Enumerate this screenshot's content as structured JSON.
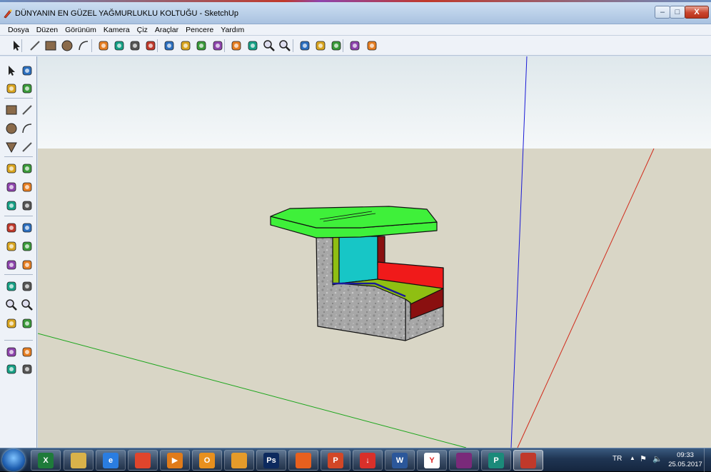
{
  "window": {
    "title": "DÜNYANIN EN GÜZEL YAĞMURLUKLU KOLTUĞU - SketchUp",
    "min_label": "–",
    "max_label": "□",
    "close_label": "X"
  },
  "menu": [
    {
      "label": "Dosya"
    },
    {
      "label": "Düzen"
    },
    {
      "label": "Görünüm"
    },
    {
      "label": "Kamera"
    },
    {
      "label": "Çiz"
    },
    {
      "label": "Araçlar"
    },
    {
      "label": "Pencere"
    },
    {
      "label": "Yardım"
    }
  ],
  "toolbar_icons": [
    "select-icon",
    "line-icon",
    "rectangle-icon",
    "circle-icon",
    "arc-icon",
    "make-component-icon",
    "eraser-icon",
    "tape-measure-icon",
    "paint-bucket-icon",
    "push-pull-icon",
    "move-icon",
    "rotate-icon",
    "follow-me-icon",
    "orbit-icon",
    "pan-icon",
    "zoom-icon",
    "zoom-extents-icon",
    "get-models-icon",
    "share-model-icon",
    "google-earth-icon",
    "component-window-icon",
    "extension-icon"
  ],
  "left_toolbar_icons": [
    "select-icon",
    "make-component-icon",
    "paint-bucket-icon",
    "eraser-icon",
    "rectangle-icon",
    "line-icon",
    "circle-icon",
    "arc-icon",
    "polygon-icon",
    "freehand-icon",
    "move-icon",
    "push-pull-icon",
    "rotate-icon",
    "follow-me-icon",
    "scale-icon",
    "offset-icon",
    "tape-measure-icon",
    "dimensions-icon",
    "protractor-icon",
    "text-icon",
    "axes-icon",
    "3d-text-icon",
    "orbit-icon",
    "pan-icon",
    "zoom-icon",
    "zoom-window-icon",
    "previous-view-icon",
    "next-view-icon",
    "position-camera-icon",
    "look-around-icon",
    "walk-icon",
    "section-plane-icon"
  ],
  "scene": {
    "sky_top": "#dfe8ec",
    "sky_bottom": "#f5f8f9",
    "ground": "#d9d6c6",
    "axis_red": "#d12a1a",
    "axis_green": "#1aa51a",
    "axis_blue": "#1a1ad6"
  },
  "model": {
    "roof_color": "#3ff03a",
    "concrete_color": "#a7a7a7",
    "cyan_panel": "#17c6c6",
    "red_panel": "#f01a1a",
    "olive_panel": "#8fbf12",
    "dark_red_panel": "#8a1010",
    "blue_edge": "#1a1a9a"
  },
  "taskbar": {
    "items": [
      {
        "name": "excel-icon",
        "glyph": "X",
        "color": "#1e7b3a"
      },
      {
        "name": "file-explorer-icon",
        "glyph": "",
        "color": "#d9b24a"
      },
      {
        "name": "internet-explorer-icon",
        "glyph": "e",
        "color": "#2a7de1"
      },
      {
        "name": "chrome-icon",
        "glyph": "",
        "color": "#e0452c"
      },
      {
        "name": "media-player-icon",
        "glyph": "▶",
        "color": "#e07b1a"
      },
      {
        "name": "outlook-icon",
        "glyph": "O",
        "color": "#e8901e"
      },
      {
        "name": "scratch-icon",
        "glyph": "",
        "color": "#e59b2a"
      },
      {
        "name": "photoshop-icon",
        "glyph": "Ps",
        "color": "#0d2a5e"
      },
      {
        "name": "firefox-icon",
        "glyph": "",
        "color": "#e8601e"
      },
      {
        "name": "powerpoint-icon",
        "glyph": "P",
        "color": "#d24726"
      },
      {
        "name": "download-icon",
        "glyph": "↓",
        "color": "#d9302a"
      },
      {
        "name": "word-icon",
        "glyph": "W",
        "color": "#2b579a"
      },
      {
        "name": "yandex-icon",
        "glyph": "Y",
        "color": "#ffffff"
      },
      {
        "name": "winrar-icon",
        "glyph": "",
        "color": "#7a2a7a"
      },
      {
        "name": "publisher-icon",
        "glyph": "P",
        "color": "#1b8a7a"
      },
      {
        "name": "sketchup-icon",
        "glyph": "",
        "color": "#c0392b"
      }
    ],
    "lang": "TR",
    "time": "09:33",
    "date": "25.05.2017"
  }
}
